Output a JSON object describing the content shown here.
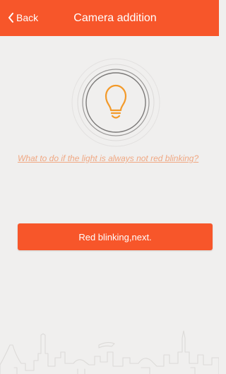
{
  "header": {
    "back_label": "Back",
    "title": "Camera addition"
  },
  "main": {
    "help_link": "What to do if the light is always not red blinking?",
    "next_button_label": "Red blinking,next."
  },
  "icons": {
    "back": "chevron-left-icon",
    "indicator": "lightbulb-icon",
    "footer": "city-skyline-illustration"
  },
  "colors": {
    "accent": "#f7562a",
    "background": "#f0efee",
    "link": "#f0a883"
  }
}
